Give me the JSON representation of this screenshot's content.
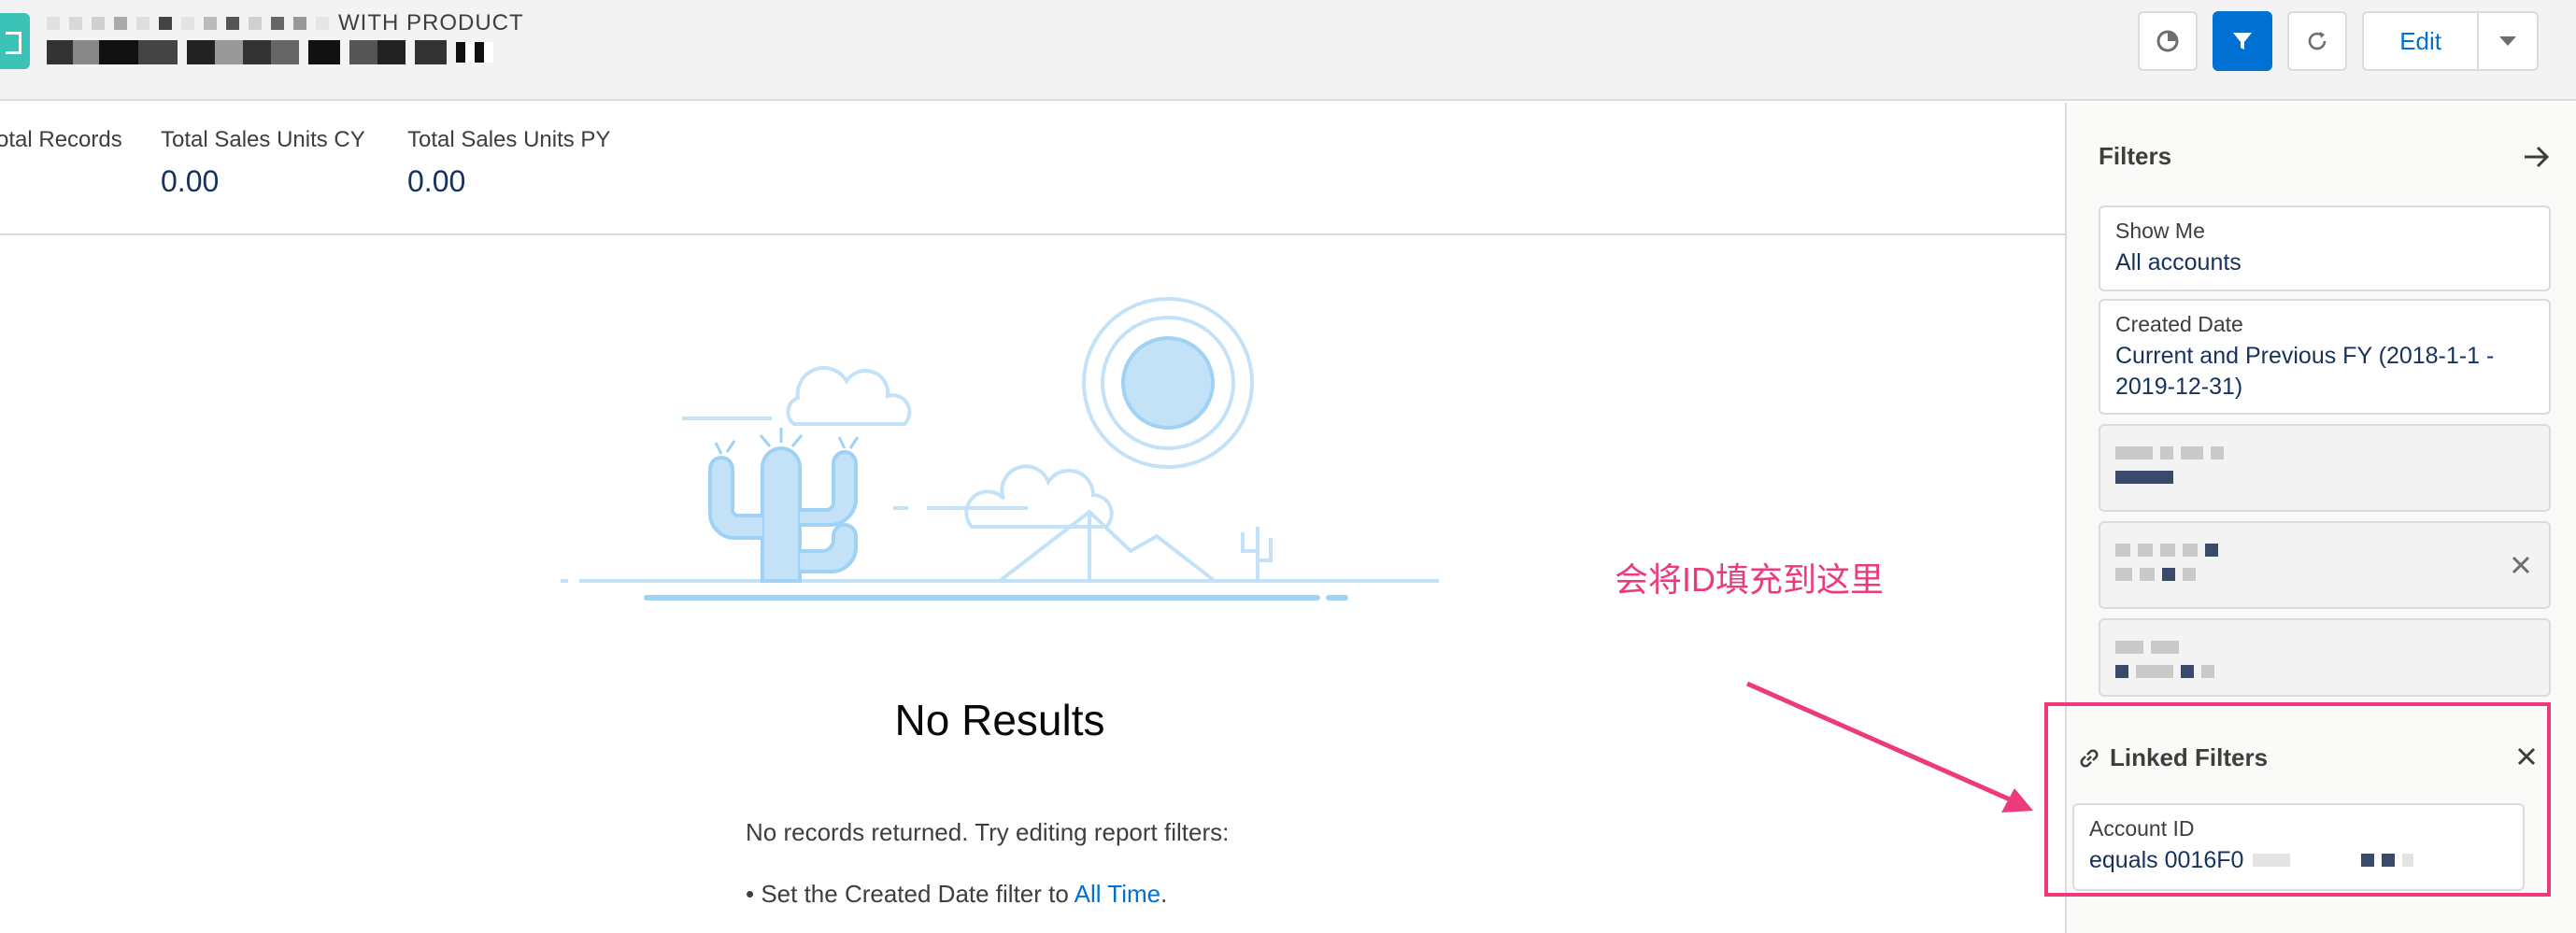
{
  "header": {
    "object_type_suffix": "WITH PRODUCT",
    "edit_label": "Edit",
    "icons": [
      "chart-icon",
      "filter-icon",
      "refresh-icon",
      "chevron-down-icon"
    ]
  },
  "summary": {
    "metrics": [
      {
        "label": "otal Records",
        "value": ""
      },
      {
        "label": "Total Sales Units CY",
        "value": "0.00"
      },
      {
        "label": "Total Sales Units PY",
        "value": "0.00"
      }
    ]
  },
  "empty_state": {
    "title": "No Results",
    "message": "No records returned. Try editing report filters:",
    "suggestion_prefix": "• Set the Created Date filter to ",
    "suggestion_link": "All Time",
    "suggestion_suffix": "."
  },
  "filters_panel": {
    "title": "Filters",
    "filters": [
      {
        "label": "Show Me",
        "value": "All accounts"
      },
      {
        "label": "Created Date",
        "value": "Current and Previous FY (2018-1-1 - 2019-12-31)"
      }
    ],
    "linked": {
      "title": "Linked Filters",
      "field_label": "Account ID",
      "field_value": "equals 0016F0"
    }
  },
  "annotation": {
    "text": "会将ID填充到这里",
    "color": "#ec3a7d"
  },
  "colors": {
    "brand_blue": "#0070d2",
    "navy_text": "#16325c",
    "illustration_light": "#c3e2f8",
    "illustration_mid": "#9fd2f5"
  }
}
